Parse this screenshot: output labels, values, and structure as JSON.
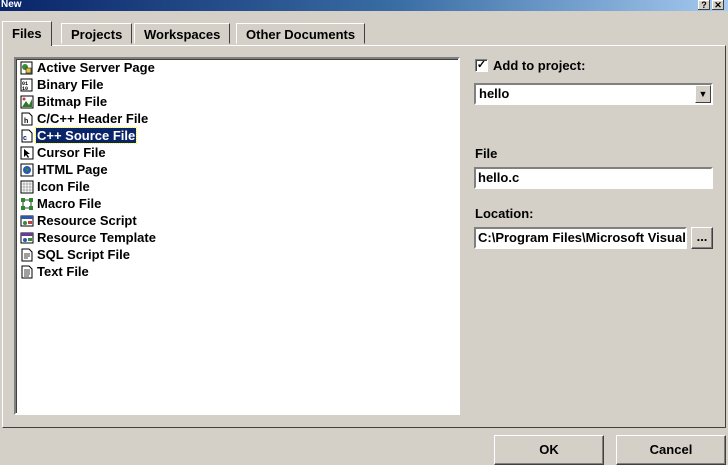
{
  "window": {
    "title": "New",
    "help_glyph": "?",
    "close_glyph": "✕"
  },
  "tabs": [
    {
      "label": "Files"
    },
    {
      "label": "Projects"
    },
    {
      "label": "Workspaces"
    },
    {
      "label": "Other Documents"
    }
  ],
  "file_types": [
    {
      "label": "Active Server Page",
      "icon": "asp-icon"
    },
    {
      "label": "Binary File",
      "icon": "binary-file-icon"
    },
    {
      "label": "Bitmap File",
      "icon": "bitmap-icon"
    },
    {
      "label": "C/C++ Header File",
      "icon": "header-file-icon"
    },
    {
      "label": "C++ Source File",
      "icon": "cpp-source-icon",
      "selected": true
    },
    {
      "label": "Cursor File",
      "icon": "cursor-icon"
    },
    {
      "label": "HTML Page",
      "icon": "html-page-icon"
    },
    {
      "label": "Icon File",
      "icon": "icon-file-icon"
    },
    {
      "label": "Macro File",
      "icon": "macro-icon"
    },
    {
      "label": "Resource Script",
      "icon": "resource-script-icon"
    },
    {
      "label": "Resource Template",
      "icon": "resource-template-icon"
    },
    {
      "label": "SQL Script File",
      "icon": "sql-script-icon"
    },
    {
      "label": "Text File",
      "icon": "text-file-icon"
    }
  ],
  "add_to_project": {
    "label": "Add to project:",
    "checked": true,
    "check_glyph": "✓",
    "project": "hello",
    "drop_glyph": "▼"
  },
  "file": {
    "label": "File",
    "value": "hello.c"
  },
  "location": {
    "label": "Location:",
    "value": "C:\\Program Files\\Microsoft Visual",
    "browse_label": "..."
  },
  "buttons": {
    "ok": "OK",
    "cancel": "Cancel"
  }
}
